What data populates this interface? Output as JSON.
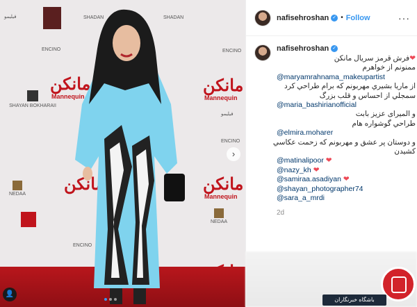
{
  "post": {
    "username": "nafisehroshan",
    "follow_label": "Follow",
    "separator": "•",
    "more_label": "···",
    "timestamp": "2d"
  },
  "caption": {
    "username": "nafisehroshan",
    "lines": [
      {
        "text": "فرش قرمز سريال مانكن",
        "type": "rtl",
        "heart": true
      },
      {
        "text": "ممنونم از خواهرم",
        "type": "rtl",
        "heart": false
      },
      {
        "text": "@maryamrahnama_makeupartist",
        "type": "link",
        "heart": false
      },
      {
        "text": "از ماريا بشيري مهربونم كه برام طراحي كرد",
        "type": "rtl",
        "heart": false
      },
      {
        "text": "سمجلي از احساس و قلب بزرگ",
        "type": "rtl",
        "heart": false
      },
      {
        "text": "@maria_bashirianofficial",
        "type": "link",
        "heart": false
      },
      {
        "text": "و المیرای عزيز بابت",
        "type": "rtl",
        "heart": false
      },
      {
        "text": "طراحي گوشواره هام",
        "type": "rtl",
        "heart": false
      },
      {
        "text": "@elmira.moharer",
        "type": "link",
        "heart": false
      },
      {
        "text": "و دوستان پر عشق و مهربونم كه زحمت عكاسي",
        "type": "rtl",
        "heart": false
      },
      {
        "text": "كشيدن",
        "type": "rtl",
        "heart": false
      },
      {
        "text": "@matinalipoor",
        "type": "link",
        "heart": true
      },
      {
        "text": "@nazy_kh",
        "type": "link",
        "heart": true
      },
      {
        "text": "@samiraa.asadiyan",
        "type": "link",
        "heart": true
      },
      {
        "text": "@shayan_photographer74",
        "type": "link",
        "heart": false
      },
      {
        "text": "@sara_a_mrdi",
        "type": "link",
        "heart": false
      }
    ]
  },
  "photo": {
    "backdrop_brand": "Mannequin",
    "backdrop_title": "مانکن",
    "sponsor_name": "SHAYAN BOKHARAII",
    "sponsor_encino": "ENCINO",
    "sponsor_filimo": "فیلیمو",
    "sponsor_nedaa": "NEDAA",
    "sponsor_shadan": "SHADAN",
    "next_arrow": "›",
    "slide_count": 3,
    "active_slide": 1
  },
  "watermark": {
    "text": "باشگاه خبرنگاران"
  },
  "colors": {
    "link": "#00376b",
    "follow": "#3897f0",
    "heart": "#ed4956",
    "backdrop_red": "#c0141c",
    "coat": "#7fd3ee"
  }
}
